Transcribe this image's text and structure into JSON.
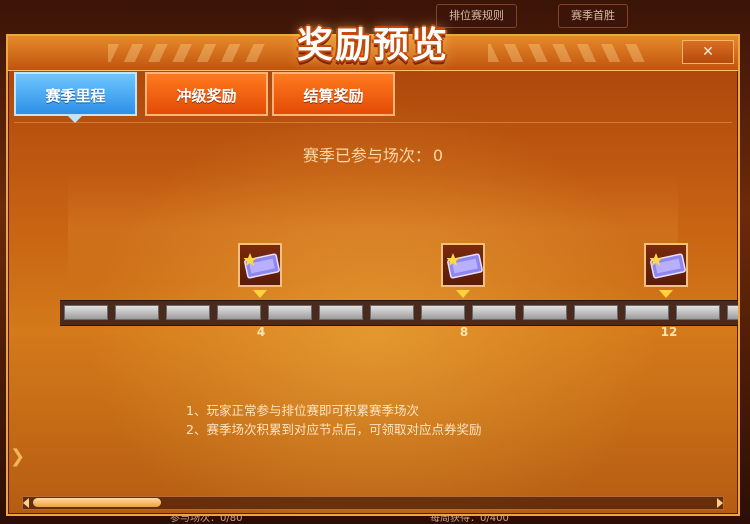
{
  "background": {
    "rules_tab": "排位赛规则",
    "season_tab": "赛季首胜",
    "stat_left_label": "参与场次：",
    "stat_left_value": "0/80",
    "stat_right_label": "每周获得：",
    "stat_right_value": "0/400"
  },
  "dialog": {
    "title": "奖励预览",
    "close_icon": "close-icon"
  },
  "tabs": [
    {
      "label": "赛季里程",
      "active": true
    },
    {
      "label": "冲级奖励",
      "active": false
    },
    {
      "label": "结算奖励",
      "active": false
    }
  ],
  "progress": {
    "label": "赛季已参与场次：",
    "value": "0"
  },
  "milestones": [
    {
      "node": "4",
      "reward_icon": "ticket-icon"
    },
    {
      "node": "8",
      "reward_icon": "ticket-icon"
    },
    {
      "node": "12",
      "reward_icon": "ticket-icon"
    }
  ],
  "rules": [
    "1、玩家正常参与排位赛即可积累赛季场次",
    "2、赛季场次积累到对应节点后，可领取对应点券奖励"
  ],
  "colors": {
    "active_tab": "#2e8fe6",
    "inactive_tab": "#e34b06",
    "panel": "#c55f12",
    "marker": "#ffd43a"
  }
}
